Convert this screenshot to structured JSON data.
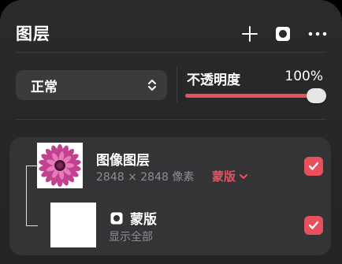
{
  "header": {
    "title": "图层",
    "icons": [
      "plus-icon",
      "mask-icon",
      "more-icon"
    ]
  },
  "blend": {
    "mode": "正常"
  },
  "opacity": {
    "label": "不透明度",
    "value_text": "100%",
    "value": 1.0
  },
  "layers": [
    {
      "name": "图像图层",
      "meta": "2848 × 2848 像素",
      "mask_link": "蒙版",
      "checked": true,
      "thumbnail": "pink-flower"
    },
    {
      "name": "蒙版",
      "meta": "显示全部",
      "checked": true,
      "thumbnail": "white"
    }
  ],
  "colors": {
    "accent": "#e8505b",
    "panel": "#2a2a2c",
    "row": "#343436"
  }
}
